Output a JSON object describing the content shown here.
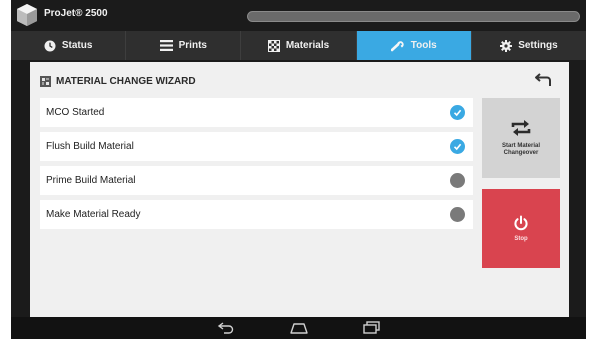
{
  "app": {
    "title": "ProJet® 2500",
    "progress": 0.0
  },
  "tabs": [
    {
      "label": "Status",
      "icon": "clock-icon",
      "active": false
    },
    {
      "label": "Prints",
      "icon": "list-icon",
      "active": false
    },
    {
      "label": "Materials",
      "icon": "checker-icon",
      "active": false
    },
    {
      "label": "Tools",
      "icon": "wrench-icon",
      "active": true
    },
    {
      "label": "Settings",
      "icon": "gear-icon",
      "active": false
    }
  ],
  "wizard": {
    "title": "MATERIAL CHANGE WIZARD",
    "steps": [
      {
        "label": "MCO Started",
        "status": "done"
      },
      {
        "label": "Flush Build Material",
        "status": "done"
      },
      {
        "label": "Prime Build Material",
        "status": "pending"
      },
      {
        "label": "Make Material Ready",
        "status": "pending"
      }
    ]
  },
  "actions": {
    "start_label": "Start Material Changeover",
    "stop_label": "Stop"
  },
  "colors": {
    "accent": "#3aa9e3",
    "stop": "#d9444f",
    "pending": "#7a7a7a"
  }
}
